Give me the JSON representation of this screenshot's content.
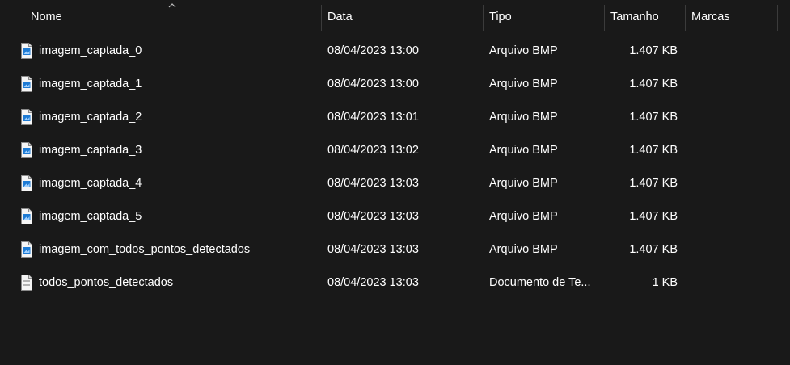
{
  "columns": {
    "name": "Nome",
    "date": "Data",
    "type": "Tipo",
    "size": "Tamanho",
    "tags": "Marcas"
  },
  "files": [
    {
      "name": "imagem_captada_0",
      "date": "08/04/2023 13:00",
      "type": "Arquivo BMP",
      "size": "1.407 KB",
      "icon": "bmp-image-icon"
    },
    {
      "name": "imagem_captada_1",
      "date": "08/04/2023 13:00",
      "type": "Arquivo BMP",
      "size": "1.407 KB",
      "icon": "bmp-image-icon"
    },
    {
      "name": "imagem_captada_2",
      "date": "08/04/2023 13:01",
      "type": "Arquivo BMP",
      "size": "1.407 KB",
      "icon": "bmp-image-icon"
    },
    {
      "name": "imagem_captada_3",
      "date": "08/04/2023 13:02",
      "type": "Arquivo BMP",
      "size": "1.407 KB",
      "icon": "bmp-image-icon"
    },
    {
      "name": "imagem_captada_4",
      "date": "08/04/2023 13:03",
      "type": "Arquivo BMP",
      "size": "1.407 KB",
      "icon": "bmp-image-icon"
    },
    {
      "name": "imagem_captada_5",
      "date": "08/04/2023 13:03",
      "type": "Arquivo BMP",
      "size": "1.407 KB",
      "icon": "bmp-image-icon"
    },
    {
      "name": "imagem_com_todos_pontos_detectados",
      "date": "08/04/2023 13:03",
      "type": "Arquivo BMP",
      "size": "1.407 KB",
      "icon": "bmp-image-icon"
    },
    {
      "name": "todos_pontos_detectados",
      "date": "08/04/2023 13:03",
      "type": "Documento de Te...",
      "size": "1 KB",
      "icon": "text-document-icon"
    }
  ],
  "colors": {
    "background": "#191919",
    "text": "#ffffff",
    "separator": "#3b3b3b",
    "bmp_icon_accent": "#1e7bd4"
  }
}
